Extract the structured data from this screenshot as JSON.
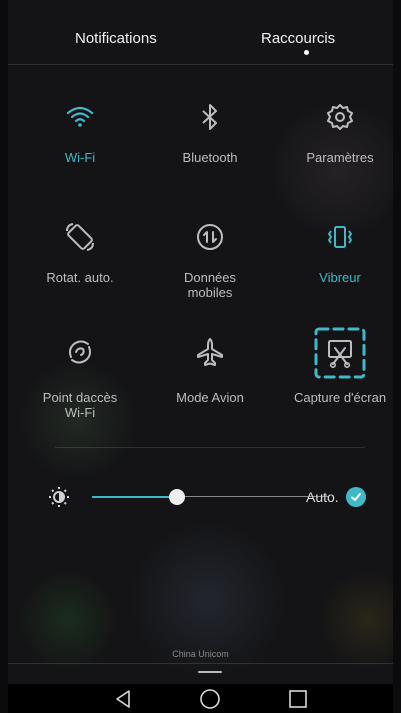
{
  "header": {
    "tabs": [
      {
        "label": "Notifications"
      },
      {
        "label": "Raccourcis"
      }
    ]
  },
  "tiles": [
    {
      "label": "Wi-Fi",
      "icon": "wifi-icon",
      "active": true
    },
    {
      "label": "Bluetooth",
      "icon": "bluetooth-icon",
      "active": false
    },
    {
      "label": "Paramètres",
      "icon": "gear-icon",
      "active": false
    },
    {
      "label": "Rotat. auto.",
      "icon": "rotate-icon",
      "active": false
    },
    {
      "label": "Données mobiles",
      "icon": "mobile-data-icon",
      "active": false
    },
    {
      "label": "Vibreur",
      "icon": "vibrate-icon",
      "active": true
    },
    {
      "label": "Point daccès Wi-Fi",
      "icon": "hotspot-icon",
      "active": false
    },
    {
      "label": "Mode Avion",
      "icon": "airplane-icon",
      "active": false
    },
    {
      "label": "Capture d'écran",
      "icon": "screenshot-icon",
      "active": false
    }
  ],
  "brightness": {
    "level": 0.36,
    "auto_label": "Auto.",
    "auto_checked": true
  },
  "carrier": "China Unicom",
  "colors": {
    "accent": "#3fb8c8",
    "inactive": "#bdbdbd",
    "background": "#141416"
  }
}
